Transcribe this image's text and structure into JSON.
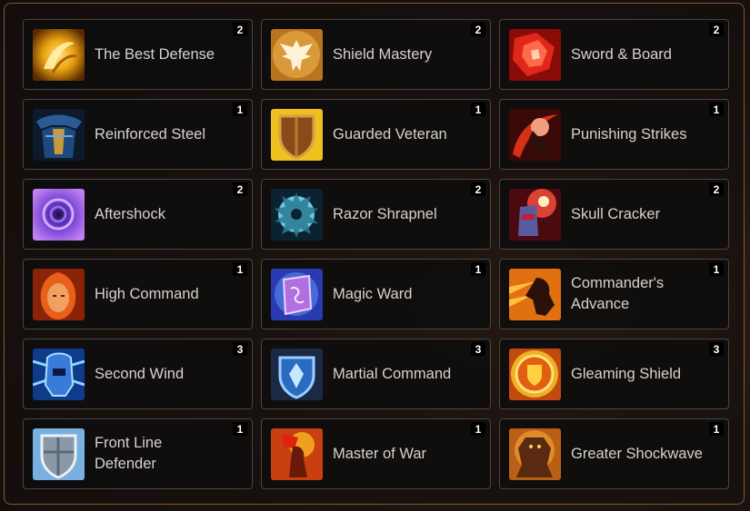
{
  "cards": [
    {
      "name": "The Best Defense",
      "count": "2",
      "icon": "golden-swirl-icon"
    },
    {
      "name": "Shield Mastery",
      "count": "2",
      "icon": "phoenix-crest-icon"
    },
    {
      "name": "Sword & Board",
      "count": "2",
      "icon": "red-shard-icon"
    },
    {
      "name": "Reinforced Steel",
      "count": "1",
      "icon": "blue-armor-icon"
    },
    {
      "name": "Guarded Veteran",
      "count": "1",
      "icon": "bronze-shield-icon"
    },
    {
      "name": "Punishing Strikes",
      "count": "1",
      "icon": "red-strike-icon"
    },
    {
      "name": "Aftershock",
      "count": "2",
      "icon": "purple-vortex-icon"
    },
    {
      "name": "Razor Shrapnel",
      "count": "2",
      "icon": "saw-blade-icon"
    },
    {
      "name": "Skull Cracker",
      "count": "2",
      "icon": "knight-burst-icon"
    },
    {
      "name": "High Command",
      "count": "1",
      "icon": "fiery-face-icon"
    },
    {
      "name": "Magic Ward",
      "count": "1",
      "icon": "magic-scroll-icon"
    },
    {
      "name": "Commander's Advance",
      "count": "1",
      "icon": "charging-warrior-icon"
    },
    {
      "name": "Second Wind",
      "count": "3",
      "icon": "blue-helmet-icon"
    },
    {
      "name": "Martial Command",
      "count": "3",
      "icon": "blue-crest-shield-icon"
    },
    {
      "name": "Gleaming Shield",
      "count": "3",
      "icon": "gleaming-shield-icon"
    },
    {
      "name": "Front Line Defender",
      "count": "1",
      "icon": "silver-shield-icon"
    },
    {
      "name": "Master of War",
      "count": "1",
      "icon": "banner-warrior-icon"
    },
    {
      "name": "Greater Shockwave",
      "count": "1",
      "icon": "golem-icon"
    }
  ]
}
